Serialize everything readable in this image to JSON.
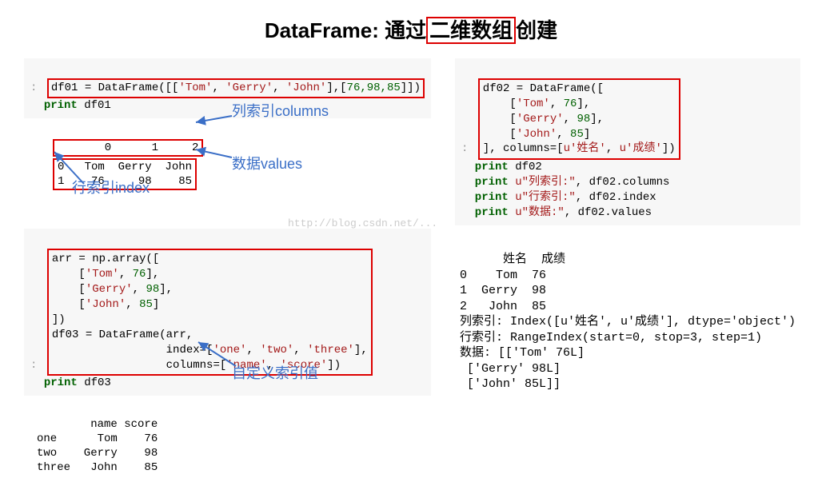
{
  "title_prefix": "DataFrame: 通过",
  "title_boxed": "二维数组",
  "title_suffix": "创建",
  "left": {
    "code1_prefix": "df01 = DataFrame([[",
    "code1_s1": "'Tom'",
    "code1_s2": "'Gerry'",
    "code1_s3": "'John'",
    "code1_nums": "76,98,85",
    "code1_suffix": "]])",
    "print1": "print",
    "print1_var": " df01",
    "table_hdr": "       0      1     2",
    "table_r0": "0   Tom  Gerry  John",
    "table_r1": "1    76     98    85",
    "annot_columns": "列索引columns",
    "annot_values": "数据values",
    "annot_index": "行索引index",
    "code2_l1": "arr = np.array([",
    "code2_l2a": "    [",
    "code2_l2s": "'Tom'",
    "code2_l2n": "76",
    "code2_l3s": "'Gerry'",
    "code2_l3n": "98",
    "code2_l4s": "'John'",
    "code2_l4n": "85",
    "code2_l5": "])",
    "code2_l6": "df03 = DataFrame(arr,",
    "code2_l7a": "                 index=[",
    "code2_l7s1": "'one'",
    "code2_l7s2": "'two'",
    "code2_l7s3": "'three'",
    "code2_l8a": "                 columns=[",
    "code2_l8s1": "'name'",
    "code2_l8s2": "'score'",
    "print3_var": " df03",
    "out3_hdr": "        name score",
    "out3_r1": "one      Tom    76",
    "out3_r2": "two    Gerry    98",
    "out3_r3": "three   John    85",
    "annot_custom": "自定义索引值"
  },
  "right": {
    "c1": "df02 = DataFrame([",
    "c2s": "'Tom'",
    "c2n": "76",
    "c3s": "'Gerry'",
    "c3n": "98",
    "c4s": "'John'",
    "c4n": "85",
    "c5a": "], columns=[",
    "c5u1": "u'姓名'",
    "c5u2": "u'成绩'",
    "p1v": " df02",
    "p2u": "u\"列索引:\"",
    "p2r": ", df02.columns",
    "p3u": "u\"行索引:\"",
    "p3r": ", df02.index",
    "p4u": "u\"数据:\"",
    "p4r": ", df02.values",
    "out_hdr": "      姓名  成绩",
    "out_r0": "0    Tom  76",
    "out_r1": "1  Gerry  98",
    "out_r2": "2   John  85",
    "out_l1": "列索引: Index([u'姓名', u'成绩'], dtype='object')",
    "out_l2": "行索引: RangeIndex(start=0, stop=3, step=1)",
    "out_l3": "数据: [['Tom' 76L]",
    "out_l4": " ['Gerry' 98L]",
    "out_l5": " ['John' 85L]]"
  },
  "watermark": "http://blog.csdn.net/..."
}
